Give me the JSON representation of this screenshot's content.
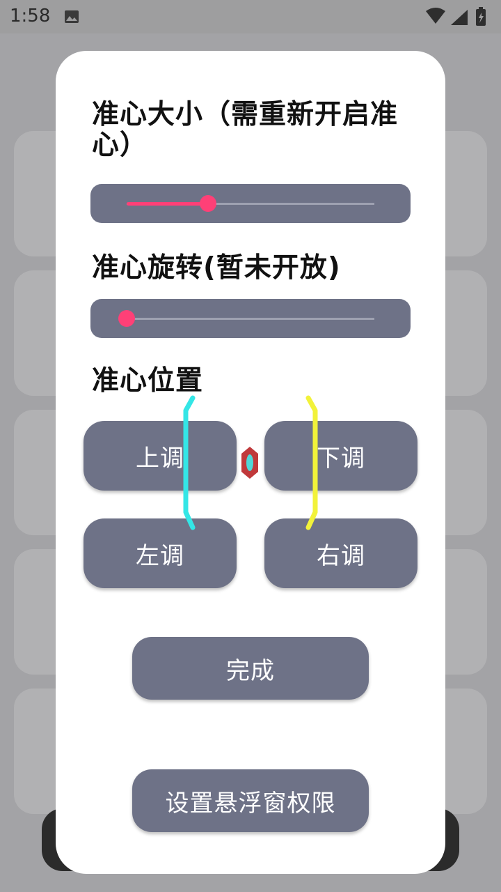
{
  "status_bar": {
    "time": "1:58"
  },
  "dialog": {
    "size_label": "准心大小（需重新开启准心）",
    "rotation_label": "准心旋转(暂未开放)",
    "position_label": "准心位置",
    "size_slider_value": 0.33,
    "rotation_slider_value": 0.0,
    "buttons": {
      "up": "上调",
      "down": "下调",
      "left": "左调",
      "right": "右调",
      "done": "完成",
      "permission": "设置悬浮窗权限"
    }
  },
  "colors": {
    "accent": "#ff4077",
    "button": "#6e7287",
    "cyan_bracket": "#34e6e6",
    "yellow_bracket": "#f2f23a",
    "crosshair": "#c0393b"
  },
  "icons": [
    "image-icon",
    "wifi-icon",
    "signal-icon",
    "battery-icon",
    "crosshair-icon"
  ]
}
